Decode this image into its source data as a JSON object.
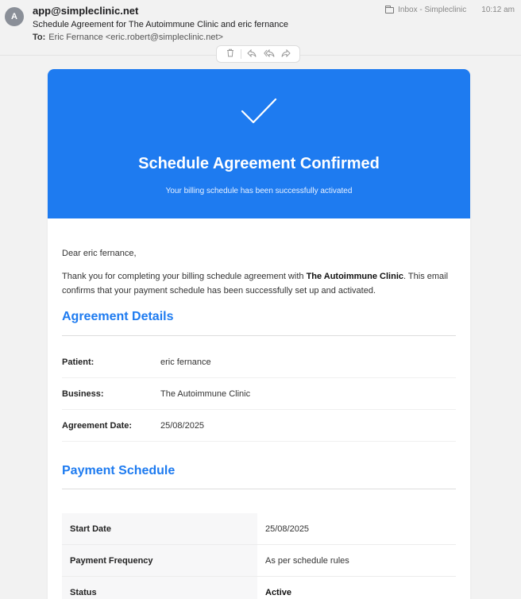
{
  "header": {
    "avatar_letter": "A",
    "sender": "app@simpleclinic.net",
    "subject": "Schedule Agreement for The Autoimmune Clinic and eric fernance",
    "to_label": "To:",
    "to_value": "Eric Fernance <eric.robert@simpleclinic.net>",
    "folder": "Inbox - Simpleclinic",
    "time": "10:12 am"
  },
  "toolbar": {
    "trash_icon": "trash-icon",
    "reply_icon": "reply-icon",
    "reply_all_icon": "reply-all-icon",
    "forward_icon": "forward-icon"
  },
  "hero": {
    "title": "Schedule Agreement Confirmed",
    "subtitle": "Your billing schedule has been successfully activated",
    "color": "#1e7bf0"
  },
  "body": {
    "greeting": "Dear eric fernance,",
    "intro_before": "Thank you for completing your billing schedule agreement with ",
    "intro_bold": "The Autoimmune Clinic",
    "intro_after": ". This email confirms that your payment schedule has been successfully set up and activated."
  },
  "agreement": {
    "title": "Agreement Details",
    "rows": [
      {
        "label": "Patient:",
        "value": "eric fernance"
      },
      {
        "label": "Business:",
        "value": "The Autoimmune Clinic"
      },
      {
        "label": "Agreement Date:",
        "value": "25/08/2025"
      }
    ]
  },
  "schedule": {
    "title": "Payment Schedule",
    "rows": [
      {
        "label": "Start Date",
        "value": "25/08/2025"
      },
      {
        "label": "Payment Frequency",
        "value": "As per schedule rules"
      },
      {
        "label": "Status",
        "value": "Active"
      }
    ]
  }
}
